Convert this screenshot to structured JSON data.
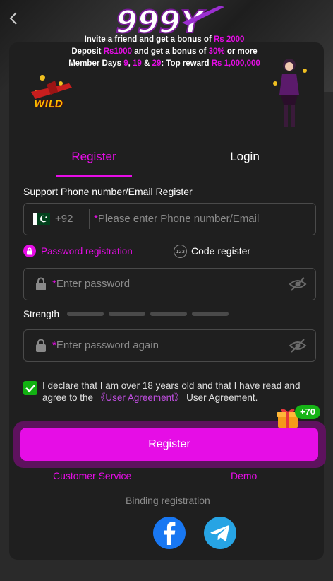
{
  "header": {
    "logo_text": "999Y",
    "back_icon": "chevron-left-icon"
  },
  "promo": {
    "badge_text": "WILD",
    "line1_pre": "Invite a friend and get a bonus of",
    "line1_amount": "Rs 2000",
    "line2_pre": "Deposit",
    "line2_amount": "Rs1000",
    "line2_mid": "and get a bonus of",
    "line2_pct": "30%",
    "line2_post": "or more",
    "line3_pre": "Member Days",
    "line3_d1": "9",
    "line3_comma": ",",
    "line3_d2": "19",
    "line3_amp": "&",
    "line3_d3": "29",
    "line3_mid": ": Top reward",
    "line3_amount": "Rs 1,000,000"
  },
  "tabs": {
    "register": "Register",
    "login": "Login"
  },
  "form": {
    "title": "Support Phone number/Email Register",
    "country_code": "+92",
    "required_mark": "*",
    "phone_placeholder": "Please enter Phone number/Email",
    "mode_password": "Password registration",
    "mode_code_icon_text": "123",
    "mode_code": "Code register",
    "password_placeholder": "Enter password",
    "strength_label": "Strength",
    "password_again_placeholder": "Enter password again",
    "agree_pre": "I declare that I am over 18 years old and that I have read and agree to the",
    "agree_link": "《User Agreement》",
    "agree_post": "User Agreement.",
    "agree_checked": true,
    "bonus_badge": "+70",
    "register_button": "Register"
  },
  "footer": {
    "customer_service": "Customer Service",
    "demo": "Demo",
    "binding_label": "Binding registration",
    "social": [
      "facebook-icon",
      "telegram-icon"
    ]
  },
  "colors": {
    "accent": "#e60de6",
    "check_green": "#12b212",
    "facebook": "#1877f2",
    "telegram": "#27a4e4"
  }
}
